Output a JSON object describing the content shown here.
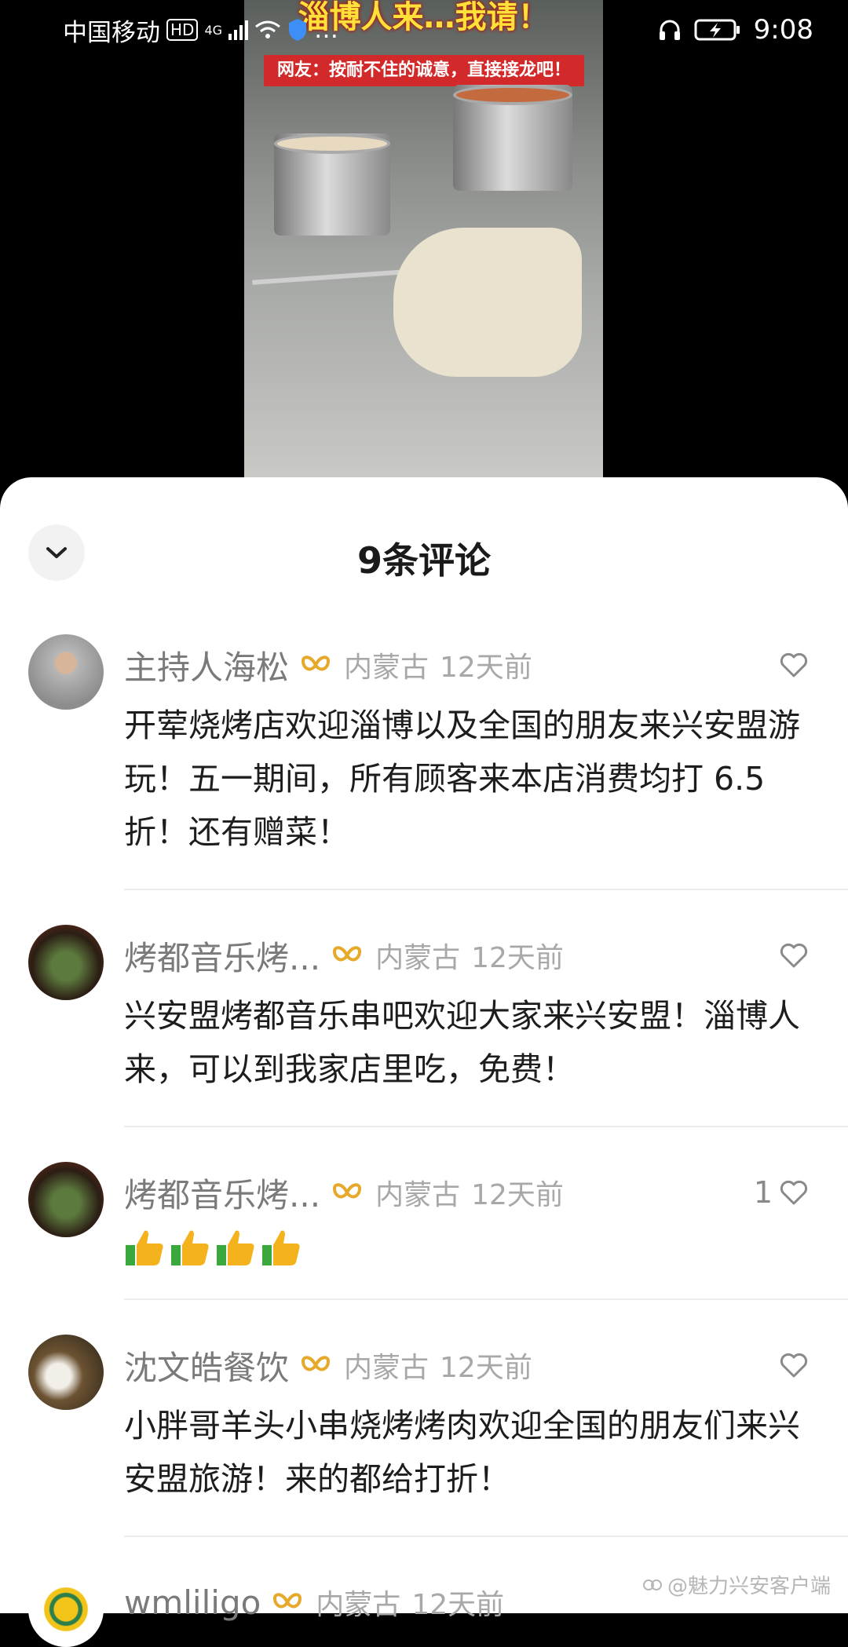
{
  "status_bar": {
    "carrier": "中国移动",
    "hd": "HD",
    "network": "4G",
    "time": "9:08",
    "ellipsis": "…"
  },
  "video": {
    "title": "淄博人来…我请！",
    "banner": "网友：按耐不住的诚意，直接接龙吧！"
  },
  "sheet": {
    "title": "9条评论"
  },
  "comments": [
    {
      "username": "主持人海松",
      "location": "内蒙古",
      "time": "12天前",
      "likes": "",
      "text": "开荤烧烤店欢迎淄博以及全国的朋友来兴安盟游玩！五一期间，所有顾客来本店消费均打 6.5 折！还有赠菜！"
    },
    {
      "username": "烤都音乐烤...",
      "location": "内蒙古",
      "time": "12天前",
      "likes": "",
      "text": "兴安盟烤都音乐串吧欢迎大家来兴安盟！淄博人来，可以到我家店里吃，免费！"
    },
    {
      "username": "烤都音乐烤...",
      "location": "内蒙古",
      "time": "12天前",
      "likes": "1",
      "text": ""
    },
    {
      "username": "沈文皓餐饮",
      "location": "内蒙古",
      "time": "12天前",
      "likes": "",
      "text": "小胖哥羊头小串烧烤烤肉欢迎全国的朋友们来兴安盟旅游！来的都给打折！"
    },
    {
      "username": "wmliligo",
      "location": "内蒙古",
      "time": "12天前",
      "likes": "",
      "text": ""
    }
  ],
  "watermark": "@魅力兴安客户端"
}
